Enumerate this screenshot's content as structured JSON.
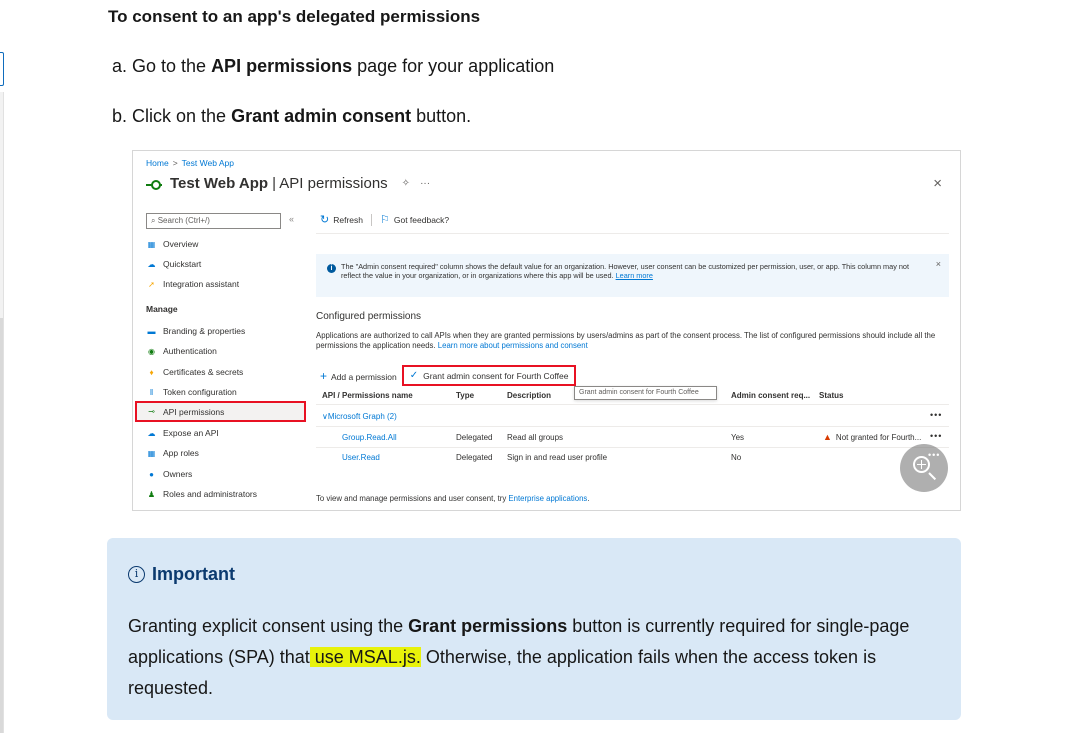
{
  "doc": {
    "heading": "To consent to an app's delegated permissions",
    "step_a": {
      "prefix": "a. Go to the ",
      "bold": "API permissions",
      "suffix": " page for your application"
    },
    "step_b": {
      "prefix": "b. Click on the ",
      "bold": "Grant admin consent",
      "suffix": " button."
    }
  },
  "screenshot": {
    "breadcrumb": {
      "home": "Home",
      "separator": ">",
      "current": "Test Web App"
    },
    "title": "Test Web App",
    "title_sub": "| API permissions",
    "close_glyph": "×",
    "search_placeholder": "Search (Ctrl+/)",
    "collapse_glyph": "«",
    "nav": [
      {
        "label": "Overview",
        "icon": "overview-icon",
        "color": "#0078d4"
      },
      {
        "label": "Quickstart",
        "icon": "quickstart-icon",
        "color": "#0078d4"
      },
      {
        "label": "Integration assistant",
        "icon": "rocket-icon",
        "color": "#f7a707"
      }
    ],
    "nav_section": "Manage",
    "nav_manage": [
      {
        "label": "Branding & properties",
        "icon": "branding-icon",
        "color": "#0078d4"
      },
      {
        "label": "Authentication",
        "icon": "authentication-icon",
        "color": "#107c10"
      },
      {
        "label": "Certificates & secrets",
        "icon": "key-icon",
        "color": "#f7a707"
      },
      {
        "label": "Token configuration",
        "icon": "token-icon",
        "color": "#0078d4"
      },
      {
        "label": "API permissions",
        "icon": "api-permissions-icon",
        "color": "#107c10"
      },
      {
        "label": "Expose an API",
        "icon": "cloud-icon",
        "color": "#0078d4"
      },
      {
        "label": "App roles",
        "icon": "app-roles-icon",
        "color": "#0078d4"
      },
      {
        "label": "Owners",
        "icon": "owners-icon",
        "color": "#0078d4"
      },
      {
        "label": "Roles and administrators",
        "icon": "roles-icon",
        "color": "#107c10"
      }
    ],
    "toolbar": {
      "refresh": "Refresh",
      "feedback": "Got feedback?"
    },
    "info": {
      "text": "The \"Admin consent required\" column shows the default value for an organization. However, user consent can be customized per permission, user, or app. This column may not reflect the value in your organization, or in organizations where this app will be used.",
      "link": "Learn more"
    },
    "configured": {
      "title": "Configured permissions",
      "desc": "Applications are authorized to call APIs when they are granted permissions by users/admins as part of the consent process. The list of configured permissions should include all the permissions the application needs.",
      "desc_link": "Learn more about permissions and consent"
    },
    "actions": {
      "add": "Add a permission",
      "grant": "Grant admin consent for Fourth Coffee"
    },
    "tooltip": "Grant admin consent for Fourth Coffee",
    "columns": [
      "API / Permissions name",
      "Type",
      "Description",
      "Admin consent req...",
      "Status"
    ],
    "group": "Microsoft Graph (2)",
    "rows": [
      {
        "name": "Group.Read.All",
        "type": "Delegated",
        "description": "Read all groups",
        "admin": "Yes",
        "status": "Not granted for Fourth..."
      },
      {
        "name": "User.Read",
        "type": "Delegated",
        "description": "Sign in and read user profile",
        "admin": "No",
        "status": ""
      }
    ],
    "ellipsis": "•••",
    "footer": {
      "text": "To view and manage permissions and user consent, try ",
      "link": "Enterprise applications",
      "end": "."
    }
  },
  "callout": {
    "title": "Important",
    "body_1": "Granting explicit consent using the ",
    "body_bold": "Grant permissions",
    "body_2": " button is currently required for single-page applications (SPA) tha",
    "body_hl_lead": "t",
    "body_hl": " use MSAL.js.",
    "body_3": " Otherwise, the application fails when the access token is requested."
  },
  "colors": {
    "accent": "#0078d4",
    "error_outline": "#e81123",
    "callout_bg": "#d9e8f6",
    "highlight": "#e8f20a"
  }
}
